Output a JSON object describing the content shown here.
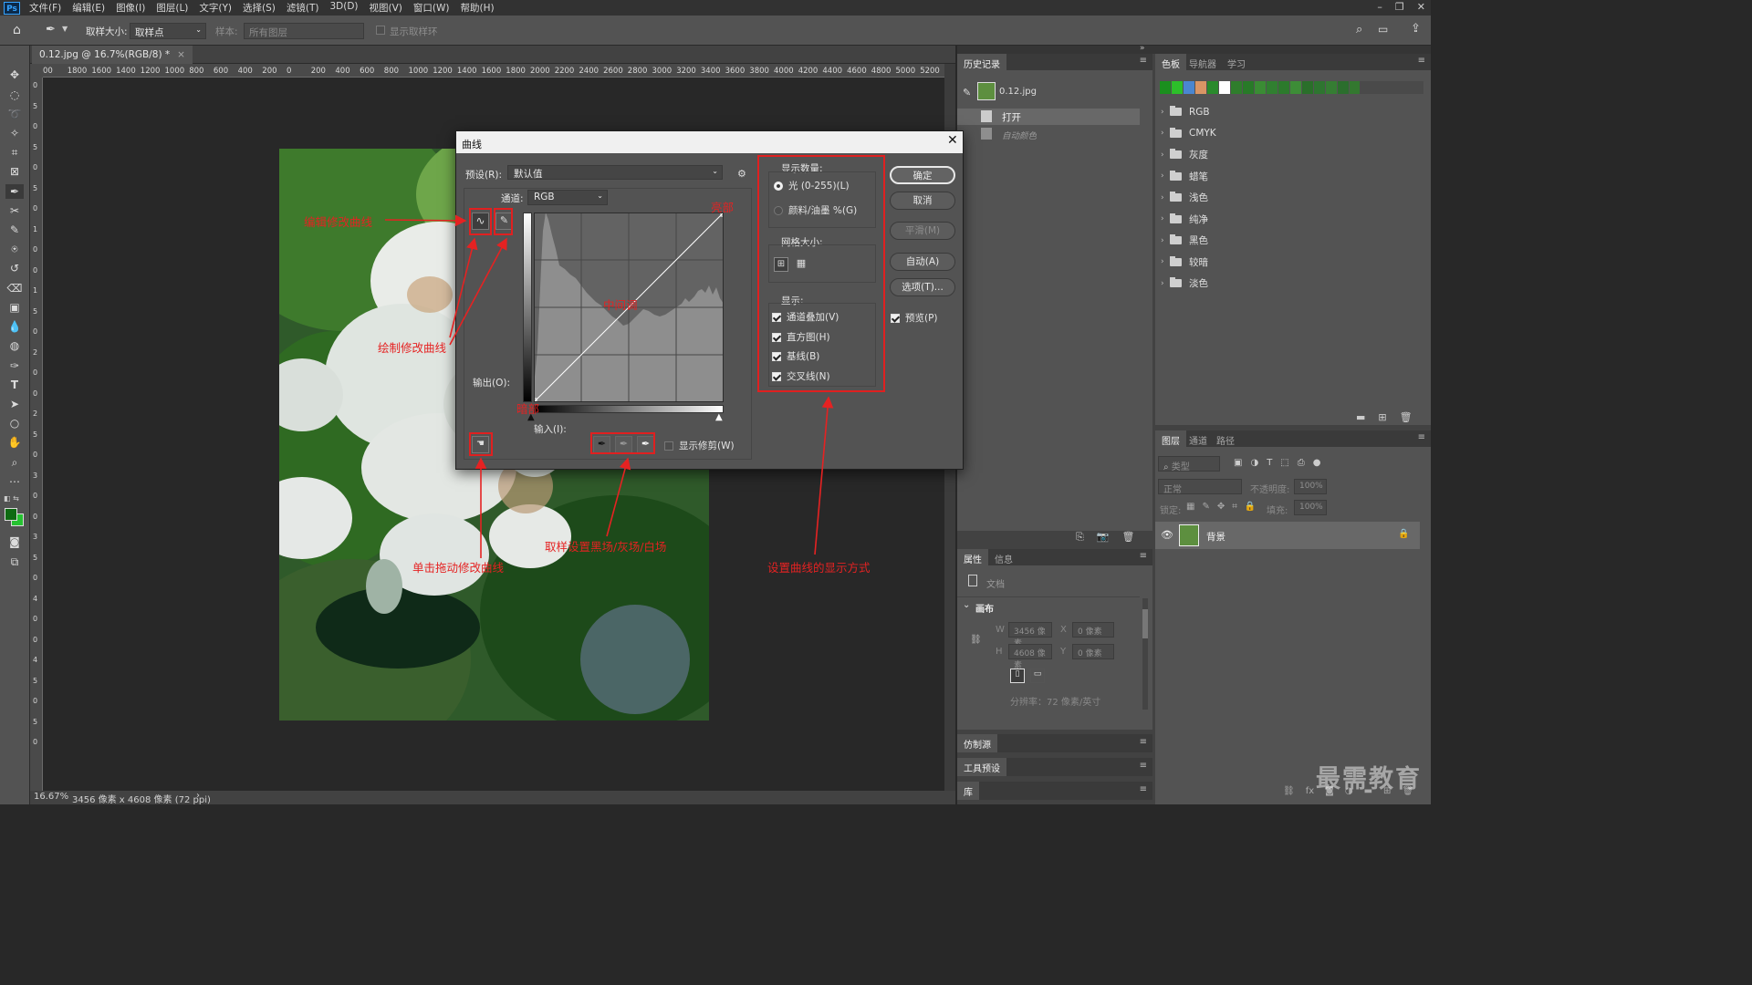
{
  "app": {
    "logo": "Ps"
  },
  "menu": [
    "文件(F)",
    "编辑(E)",
    "图像(I)",
    "图层(L)",
    "文字(Y)",
    "选择(S)",
    "滤镜(T)",
    "3D(D)",
    "视图(V)",
    "窗口(W)",
    "帮助(H)"
  ],
  "options": {
    "sample_size_label": "取样大小:",
    "sample_size_value": "取样点",
    "sample_label": "样本:",
    "sample_value": "所有图层",
    "show_ring_label": "显示取样环"
  },
  "document": {
    "tab_title": "0.12.jpg @ 16.7%(RGB/8) *",
    "zoom": "16.67%",
    "info": "3456 像素 x 4608 像素 (72 ppi)"
  },
  "ruler_h": [
    "00",
    "1800",
    "1600",
    "1400",
    "1200",
    "1000",
    "800",
    "600",
    "400",
    "200",
    "0",
    "200",
    "400",
    "600",
    "800",
    "1000",
    "1200",
    "1400",
    "1600",
    "1800",
    "2000",
    "2200",
    "2400",
    "2600",
    "2800",
    "3000",
    "3200",
    "3400",
    "3600",
    "3800",
    "4000",
    "4200",
    "4400",
    "4600",
    "4800",
    "5000",
    "5200"
  ],
  "ruler_v": [
    "0",
    "5",
    "0",
    "5",
    "0",
    "5",
    "0",
    "1",
    "0",
    "0",
    "1",
    "5",
    "0",
    "2",
    "0",
    "0",
    "2",
    "5",
    "0",
    "3",
    "0",
    "0",
    "3",
    "5",
    "0",
    "4",
    "0",
    "0",
    "4",
    "5",
    "0",
    "5",
    "0"
  ],
  "history_panel": {
    "tab": "历史记录",
    "snapshot": "0.12.jpg",
    "items": [
      "打开",
      "自动颜色"
    ]
  },
  "swatches_panel": {
    "tabs": [
      "色板",
      "导航器",
      "学习"
    ],
    "colors": [
      "#1b8f1e",
      "#2dbf2a",
      "#4a86d0",
      "#d99565",
      "#2a8a2c",
      "#ffffff",
      "#2f7d2c",
      "#287a28",
      "#3a8c34",
      "#307f30",
      "#2c7a2c",
      "#3d8d37",
      "#2a6f2a",
      "#2e7530",
      "#357d33",
      "#2b6e2d",
      "#33782f",
      "#2c6c2b"
    ],
    "groups": [
      "RGB",
      "CMYK",
      "灰度",
      "蜡笔",
      "浅色",
      "纯净",
      "黑色",
      "较暗",
      "淡色"
    ]
  },
  "layers_panel": {
    "tabs": [
      "图层",
      "通道",
      "路径"
    ],
    "filter_placeholder": "类型",
    "blend_mode": "正常",
    "opacity_label": "不透明度:",
    "opacity_value": "100%",
    "lock_label": "锁定:",
    "fill_label": "填充:",
    "fill_value": "100%",
    "layer_name": "背景"
  },
  "properties_panel": {
    "tabs": [
      "属性",
      "信息"
    ],
    "doc_label": "文档",
    "section": "画布",
    "w_label": "W",
    "w_value": "3456 像素",
    "h_label": "H",
    "h_value": "4608 像素",
    "x_label": "X",
    "x_value": "0 像素",
    "y_label": "Y",
    "y_value": "0 像素",
    "resolution": "分辨率：72 像素/英寸"
  },
  "collapsed_panels": [
    "仿制源",
    "工具预设",
    "库"
  ],
  "curves_dialog": {
    "title": "曲线",
    "preset_label": "预设(R):",
    "preset_value": "默认值",
    "channel_label": "通道:",
    "channel_value": "RGB",
    "output_label": "输出(O):",
    "input_label": "输入(I):",
    "show_clipping": "显示修剪(W)",
    "display_amount_title": "显示数量:",
    "light_option": "光 (0-255)(L)",
    "pigment_option": "颜料/油墨 %(G)",
    "grid_size_title": "网格大小:",
    "show_title": "显示:",
    "show_options": [
      "通道叠加(V)",
      "直方图(H)",
      "基线(B)",
      "交叉线(N)"
    ],
    "buttons": {
      "ok": "确定",
      "cancel": "取消",
      "smooth": "平滑(M)",
      "auto": "自动(A)",
      "options": "选项(T)..."
    },
    "preview": "预览(P)"
  },
  "annotations": {
    "edit_curve": "编辑修改曲线",
    "draw_curve": "绘制修改曲线",
    "highlights": "亮部",
    "midtones": "中间调",
    "shadows": "暗部",
    "drag_curve": "单击拖动修改曲线",
    "eyedroppers": "取样设置黑场/灰场/白场",
    "display_mode": "设置曲线的显示方式"
  },
  "watermark": "最需教育",
  "colors": {
    "annotation_red": "#e52222",
    "panel_bg": "#424242",
    "dialog_bg": "#535353"
  }
}
